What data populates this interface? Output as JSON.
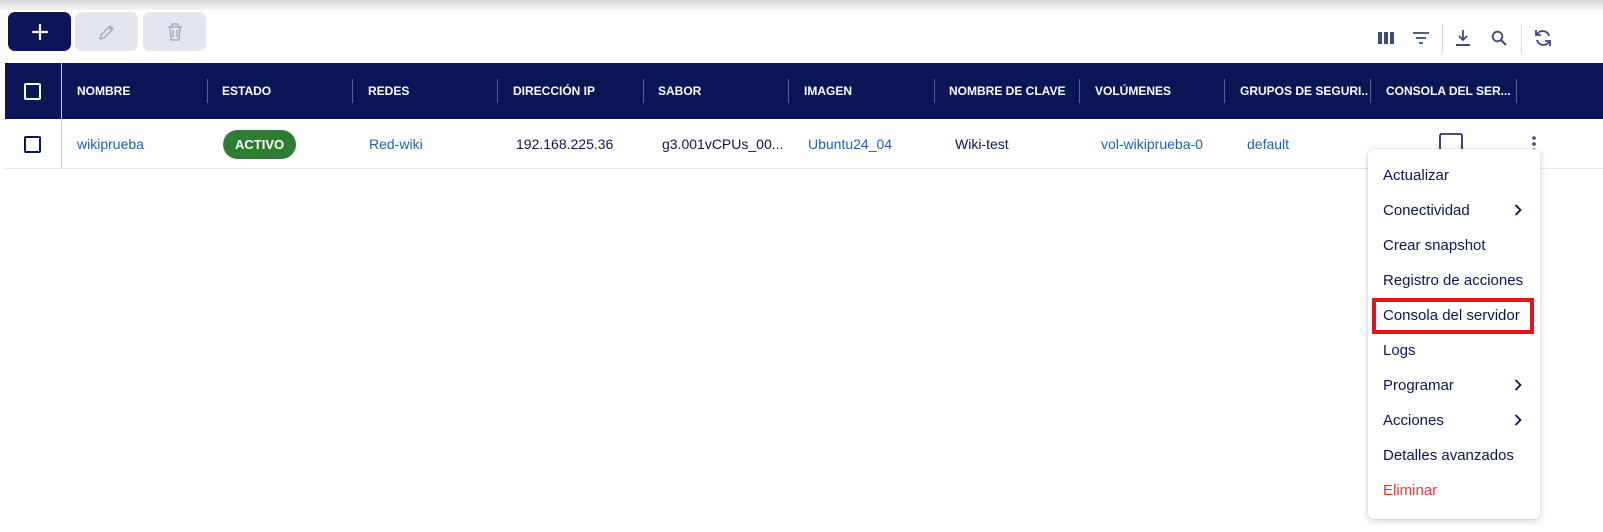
{
  "toolbar": {
    "add_icon": "plus-icon",
    "edit_icon": "pencil-icon",
    "delete_icon": "trash-icon",
    "right_icons": [
      "columns-icon",
      "filter-icon",
      "download-icon",
      "search-icon",
      "refresh-icon"
    ]
  },
  "table": {
    "headers": [
      "NOMBRE",
      "ESTADO",
      "REDES",
      "DIRECCIÓN IP",
      "SABOR",
      "IMAGEN",
      "NOMBRE DE CLAVE",
      "VOLÚMENES",
      "GRUPOS DE SEGURI...",
      "CONSOLA DEL SER..."
    ],
    "row": {
      "nombre": "wikiprueba",
      "estado": "ACTIVO",
      "redes": "Red-wiki",
      "ip": "192.168.225.36",
      "sabor": "g3.001vCPUs_00...",
      "imagen": "Ubuntu24_04",
      "clave": "Wiki-test",
      "volumenes": "vol-wikiprueba-0",
      "grupos": "default"
    }
  },
  "menu": {
    "items": [
      "Actualizar",
      "Conectividad",
      "Crear snapshot",
      "Registro de acciones",
      "Consola del servidor",
      "Logs",
      "Programar",
      "Acciones",
      "Detalles avanzados",
      "Eliminar"
    ],
    "highlighted": "Consola del servidor"
  },
  "colors": {
    "navy": "#0a1656",
    "link": "#1e5fb3",
    "active_badge": "#2e7d32",
    "danger": "#e53935",
    "highlight_border": "#e8101b"
  }
}
